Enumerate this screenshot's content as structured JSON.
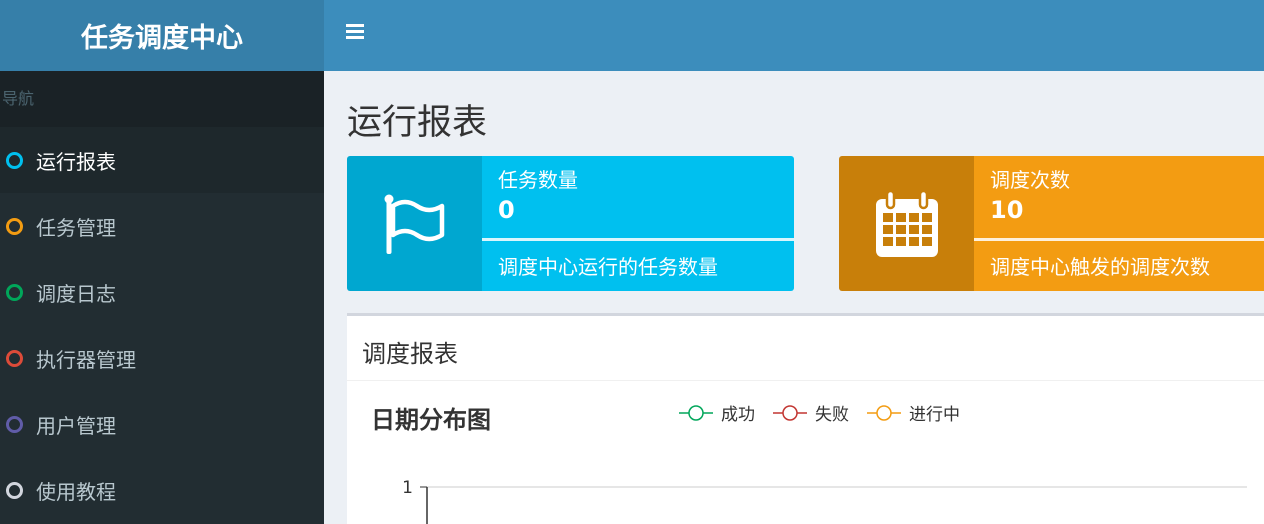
{
  "app": {
    "title": "任务调度中心"
  },
  "sidebar": {
    "header": "导航",
    "items": [
      {
        "label": "运行报表",
        "color": "#00c0ef",
        "active": true
      },
      {
        "label": "任务管理",
        "color": "#f39c12"
      },
      {
        "label": "调度日志",
        "color": "#00a65a"
      },
      {
        "label": "执行器管理",
        "color": "#dd4b39"
      },
      {
        "label": "用户管理",
        "color": "#605ca8"
      },
      {
        "label": "使用教程",
        "color": "#d2d6de"
      }
    ]
  },
  "main": {
    "page_title": "运行报表",
    "infoboxes": [
      {
        "title": "任务数量",
        "value": "0",
        "desc": "调度中心运行的任务数量",
        "icon": "flag-icon",
        "bg": "#00c0ef",
        "icon_bg": "#00a7d0"
      },
      {
        "title": "调度次数",
        "value": "10",
        "desc": "调度中心触发的调度次数",
        "icon": "calendar-icon",
        "bg": "#f39c12",
        "icon_bg": "#c87f0a"
      }
    ],
    "report": {
      "title": "调度报表",
      "chart_title": "日期分布图"
    }
  },
  "chart_data": {
    "type": "line",
    "title": "日期分布图",
    "series": [
      {
        "name": "成功",
        "color": "#00a65a",
        "values": []
      },
      {
        "name": "失败",
        "color": "#c23531",
        "values": []
      },
      {
        "name": "进行中",
        "color": "#f39c12",
        "values": []
      }
    ],
    "y_ticks": [
      "1"
    ],
    "grid": true,
    "legend": "top"
  }
}
